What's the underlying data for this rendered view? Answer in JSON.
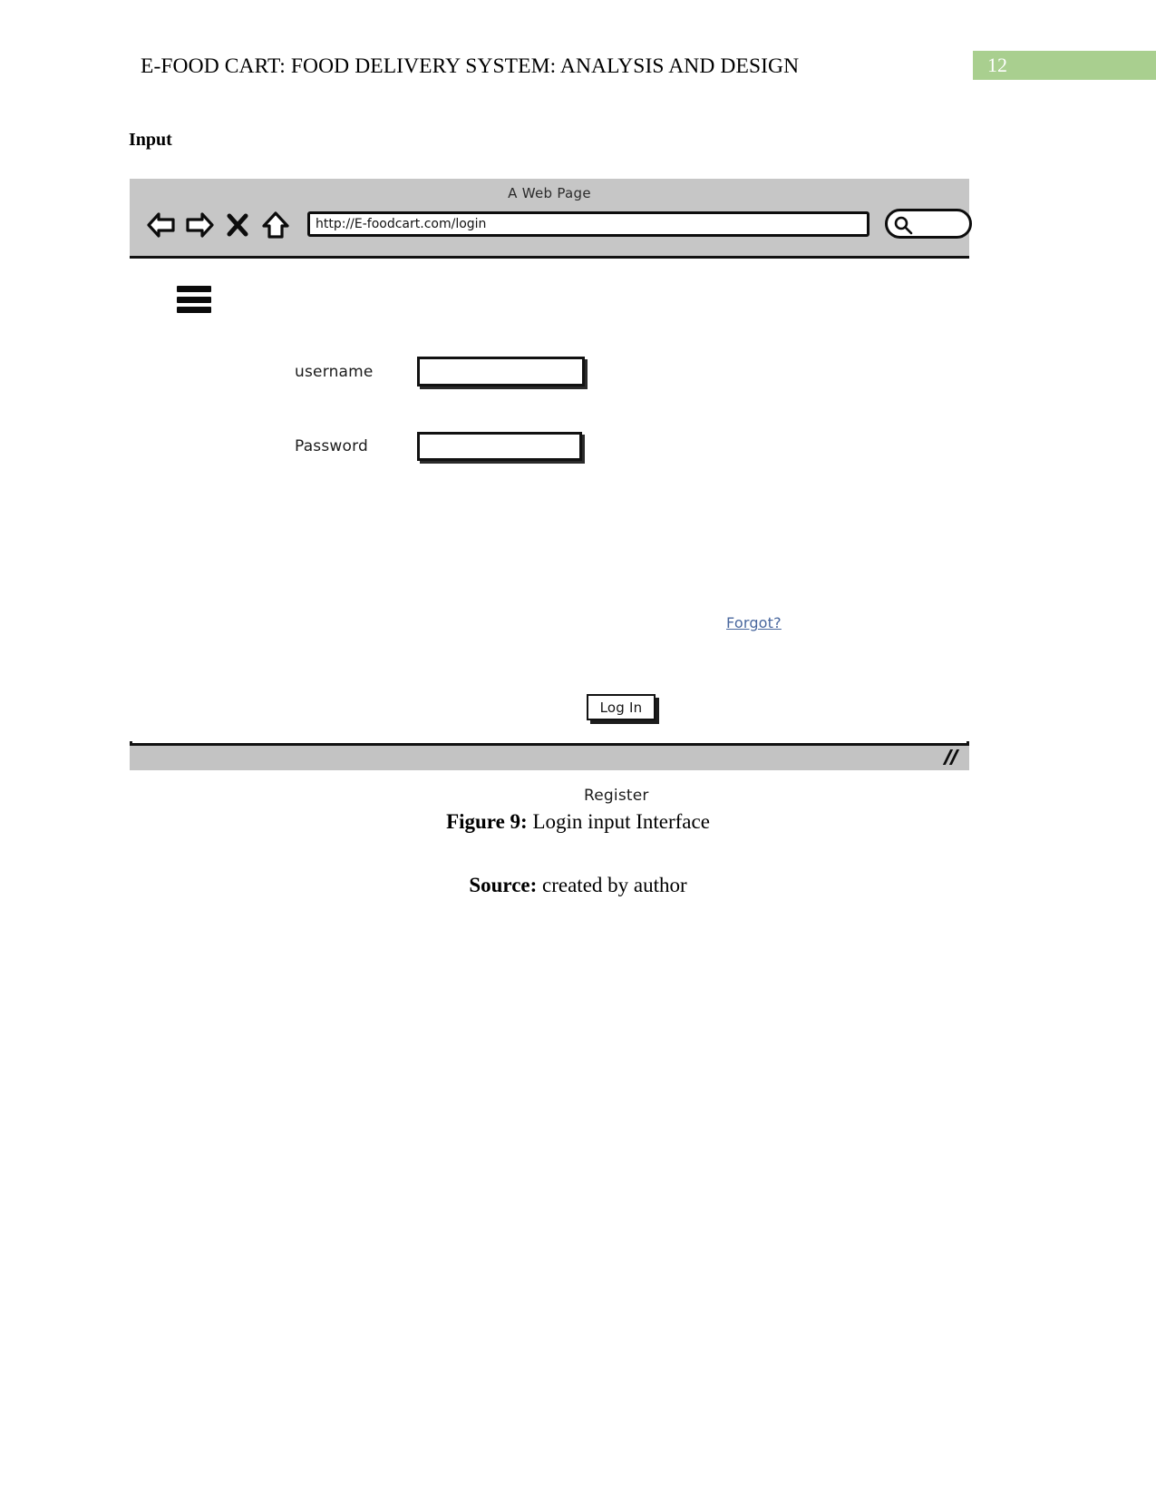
{
  "document": {
    "running_head": "E-FOOD CART: FOOD DELIVERY SYSTEM: ANALYSIS AND DESIGN",
    "page_number": "12",
    "section_heading": "Input",
    "accent_color": "#a9cf8f"
  },
  "mockup": {
    "window_title": "A Web Page",
    "toolbar": {
      "back_icon": "back-arrow-icon",
      "forward_icon": "forward-arrow-icon",
      "stop_icon": "close-x-icon",
      "home_icon": "home-icon",
      "search_icon": "magnifier-icon",
      "url_value": "http://E-foodcart.com/login",
      "url_placeholder": "http://",
      "search_value": "",
      "search_placeholder": ""
    },
    "page": {
      "menu_icon": "hamburger-menu-icon",
      "fields": [
        {
          "label": "username",
          "value": "",
          "placeholder": ""
        },
        {
          "label": "Password",
          "value": "",
          "placeholder": ""
        }
      ],
      "forgot_label": "Forgot?",
      "forgot_color": "#49679e",
      "login_button_label": "Log In",
      "register_label": "Register"
    },
    "statusbar": {
      "resize_icon": "resize-grip-icon"
    }
  },
  "captions": {
    "figure_prefix": "Figure 9:",
    "figure_text": " Login input Interface",
    "source_prefix": "Source:",
    "source_text": " created by author"
  }
}
